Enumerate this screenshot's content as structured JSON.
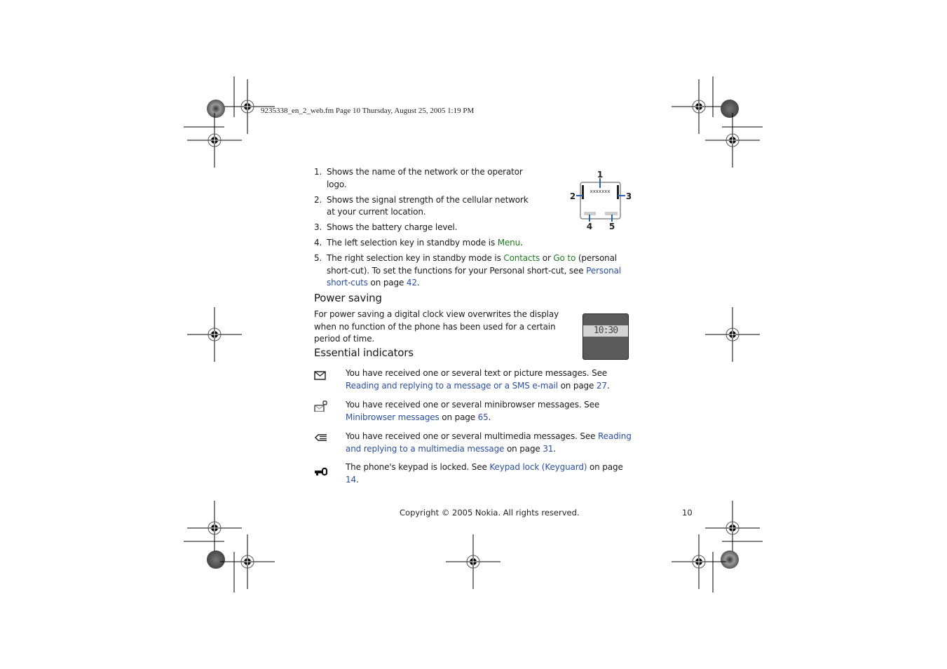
{
  "print_header": "9235338_en_2_web.fm  Page 10  Thursday, August 25, 2005  1:19 PM",
  "diagram": {
    "screen_text": "xxxxxxx",
    "callouts": [
      "1",
      "2",
      "3",
      "4",
      "5"
    ]
  },
  "list": [
    {
      "num": "1.",
      "parts": [
        {
          "t": "Shows the name of the network or the operator logo.",
          "c": ""
        }
      ]
    },
    {
      "num": "2.",
      "parts": [
        {
          "t": "Shows the signal strength of the cellular network",
          "c": ""
        },
        {
          "t": "at your current location.",
          "c": "br"
        }
      ]
    },
    {
      "num": "3.",
      "parts": [
        {
          "t": "Shows the battery charge level.",
          "c": ""
        }
      ]
    },
    {
      "num": "4.",
      "parts": [
        {
          "t": "The left selection key in standby mode is ",
          "c": ""
        },
        {
          "t": "Menu",
          "c": "green"
        },
        {
          "t": ".",
          "c": ""
        }
      ]
    },
    {
      "num": "5.",
      "parts": [
        {
          "t": "The right selection key in standby mode is ",
          "c": ""
        },
        {
          "t": "Contacts",
          "c": "green"
        },
        {
          "t": " or ",
          "c": ""
        },
        {
          "t": "Go to",
          "c": "green"
        },
        {
          "t": " (personal short-cut). To set the functions for your Personal short-cut, see ",
          "c": ""
        },
        {
          "t": "Personal short-cuts",
          "c": "blue"
        },
        {
          "t": " on page ",
          "c": ""
        },
        {
          "t": "42",
          "c": "blue"
        },
        {
          "t": ".",
          "c": ""
        }
      ]
    }
  ],
  "power_saving": {
    "heading": "Power saving",
    "text": "For power saving a digital clock view overwrites the display when no function of the phone has been used for a certain period of time.",
    "clock": "10:30"
  },
  "indicators": {
    "heading": "Essential indicators",
    "items": [
      {
        "icon": "envelope-icon",
        "parts": [
          {
            "t": "You have received one or several text or picture messages. See ",
            "c": ""
          },
          {
            "t": "Reading and replying to a message or a SMS e-mail",
            "c": "blue"
          },
          {
            "t": " on page ",
            "c": ""
          },
          {
            "t": "27",
            "c": "blue"
          },
          {
            "t": ".",
            "c": ""
          }
        ]
      },
      {
        "icon": "minibrowser-message-icon",
        "parts": [
          {
            "t": "You have received one or several minibrowser messages. See ",
            "c": ""
          },
          {
            "t": "Minibrowser messages",
            "c": "blue"
          },
          {
            "t": " on page ",
            "c": ""
          },
          {
            "t": "65",
            "c": "blue"
          },
          {
            "t": ".",
            "c": ""
          }
        ]
      },
      {
        "icon": "multimedia-message-icon",
        "parts": [
          {
            "t": "You have received one or several multimedia messages. See ",
            "c": ""
          },
          {
            "t": "Reading and replying to a multimedia message",
            "c": "blue"
          },
          {
            "t": " on page ",
            "c": ""
          },
          {
            "t": "31",
            "c": "blue"
          },
          {
            "t": ".",
            "c": ""
          }
        ]
      },
      {
        "icon": "keypad-lock-icon",
        "parts": [
          {
            "t": "The phone's keypad is locked. See ",
            "c": ""
          },
          {
            "t": "Keypad lock (Keyguard)",
            "c": "blue"
          },
          {
            "t": " on page ",
            "c": ""
          },
          {
            "t": "14",
            "c": "blue"
          },
          {
            "t": ".",
            "c": ""
          }
        ]
      }
    ]
  },
  "footer": {
    "copyright": "Copyright © 2005 Nokia. All rights reserved.",
    "page_number": "10"
  },
  "colors": {
    "term_green": "#1f7a1f",
    "link_blue": "#2a4fa0"
  }
}
